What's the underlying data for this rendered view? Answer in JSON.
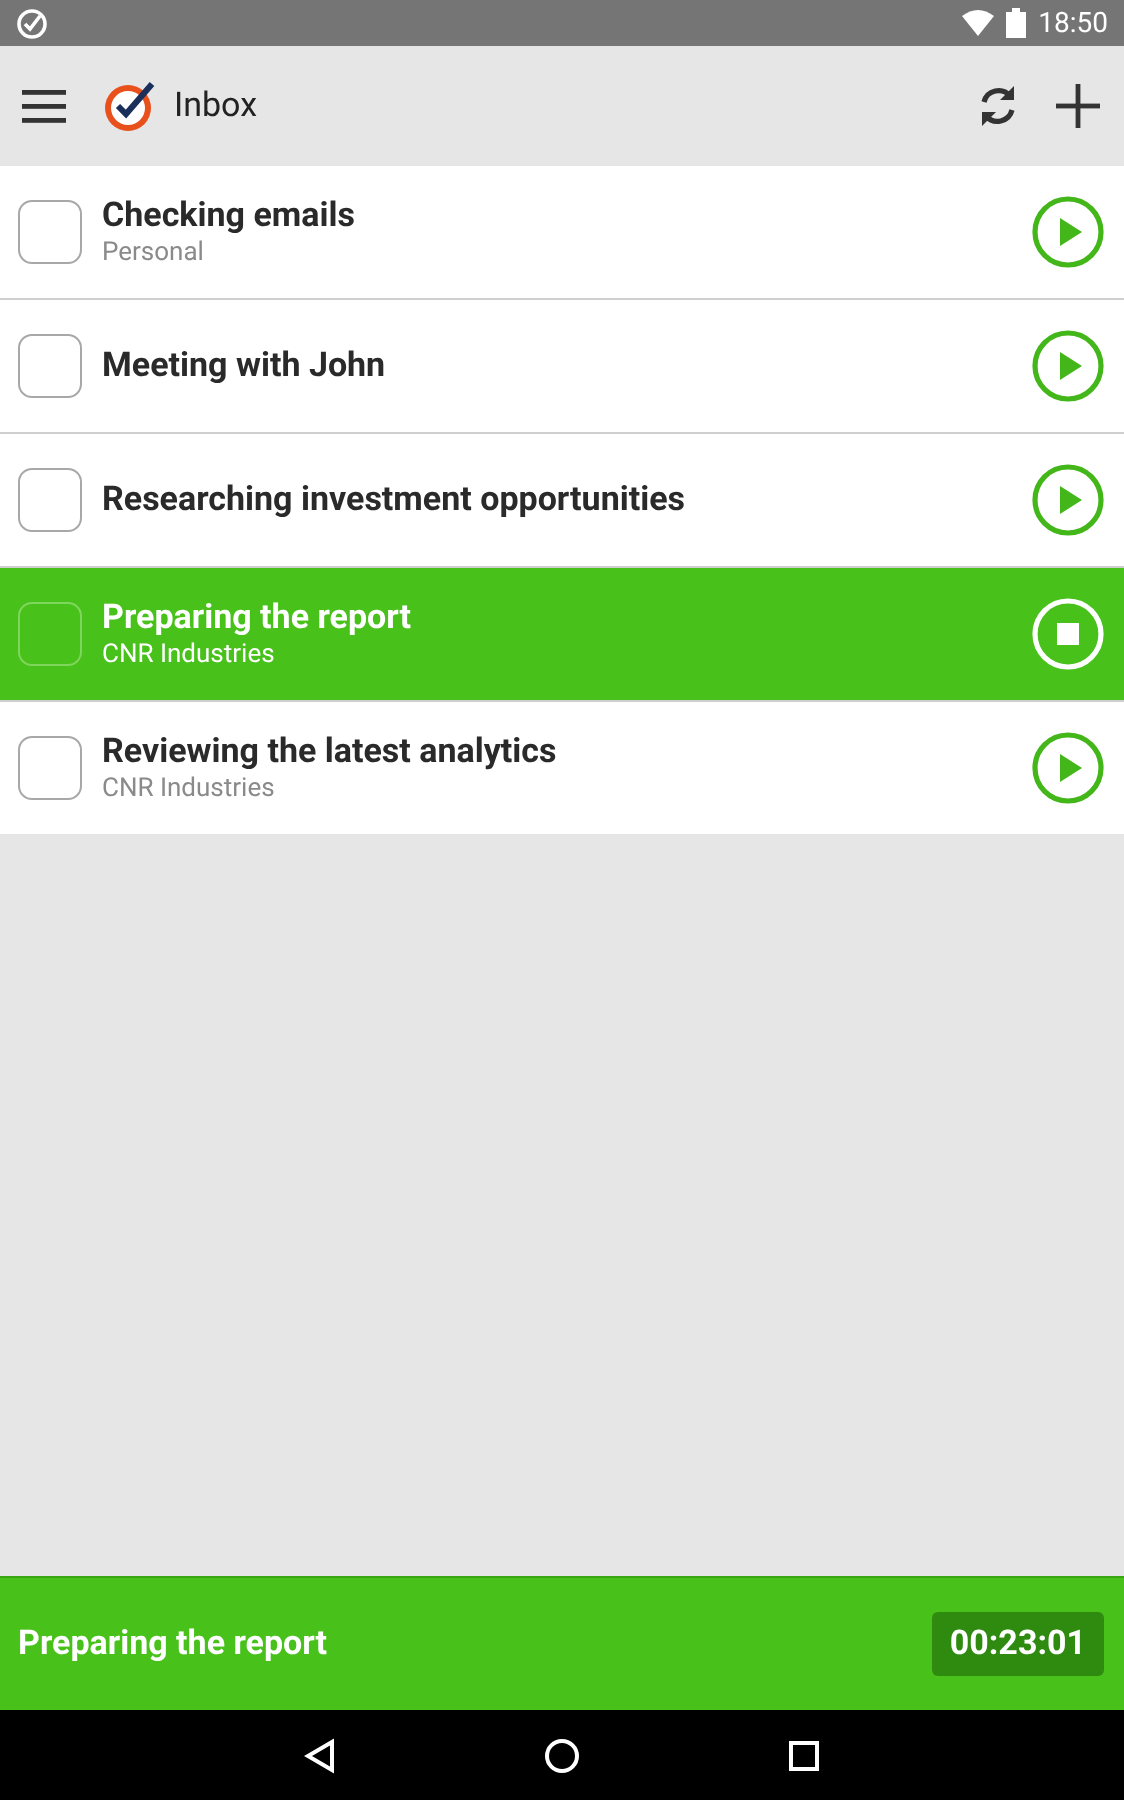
{
  "status_bar": {
    "time": "18:50"
  },
  "toolbar": {
    "title": "Inbox"
  },
  "tasks": [
    {
      "title": "Checking emails",
      "project": "Personal",
      "checked": false,
      "running": false
    },
    {
      "title": "Meeting with John",
      "checked": false,
      "running": false
    },
    {
      "title": "Researching investment opportunities",
      "checked": false,
      "running": false
    },
    {
      "title": "Preparing the report",
      "project": "CNR Industries",
      "checked": false,
      "running": true
    },
    {
      "title": "Reviewing the latest analytics",
      "project": "CNR Industries",
      "checked": false,
      "running": false
    }
  ],
  "timer_bar": {
    "task": "Preparing the report",
    "elapsed": "00:23:01"
  }
}
